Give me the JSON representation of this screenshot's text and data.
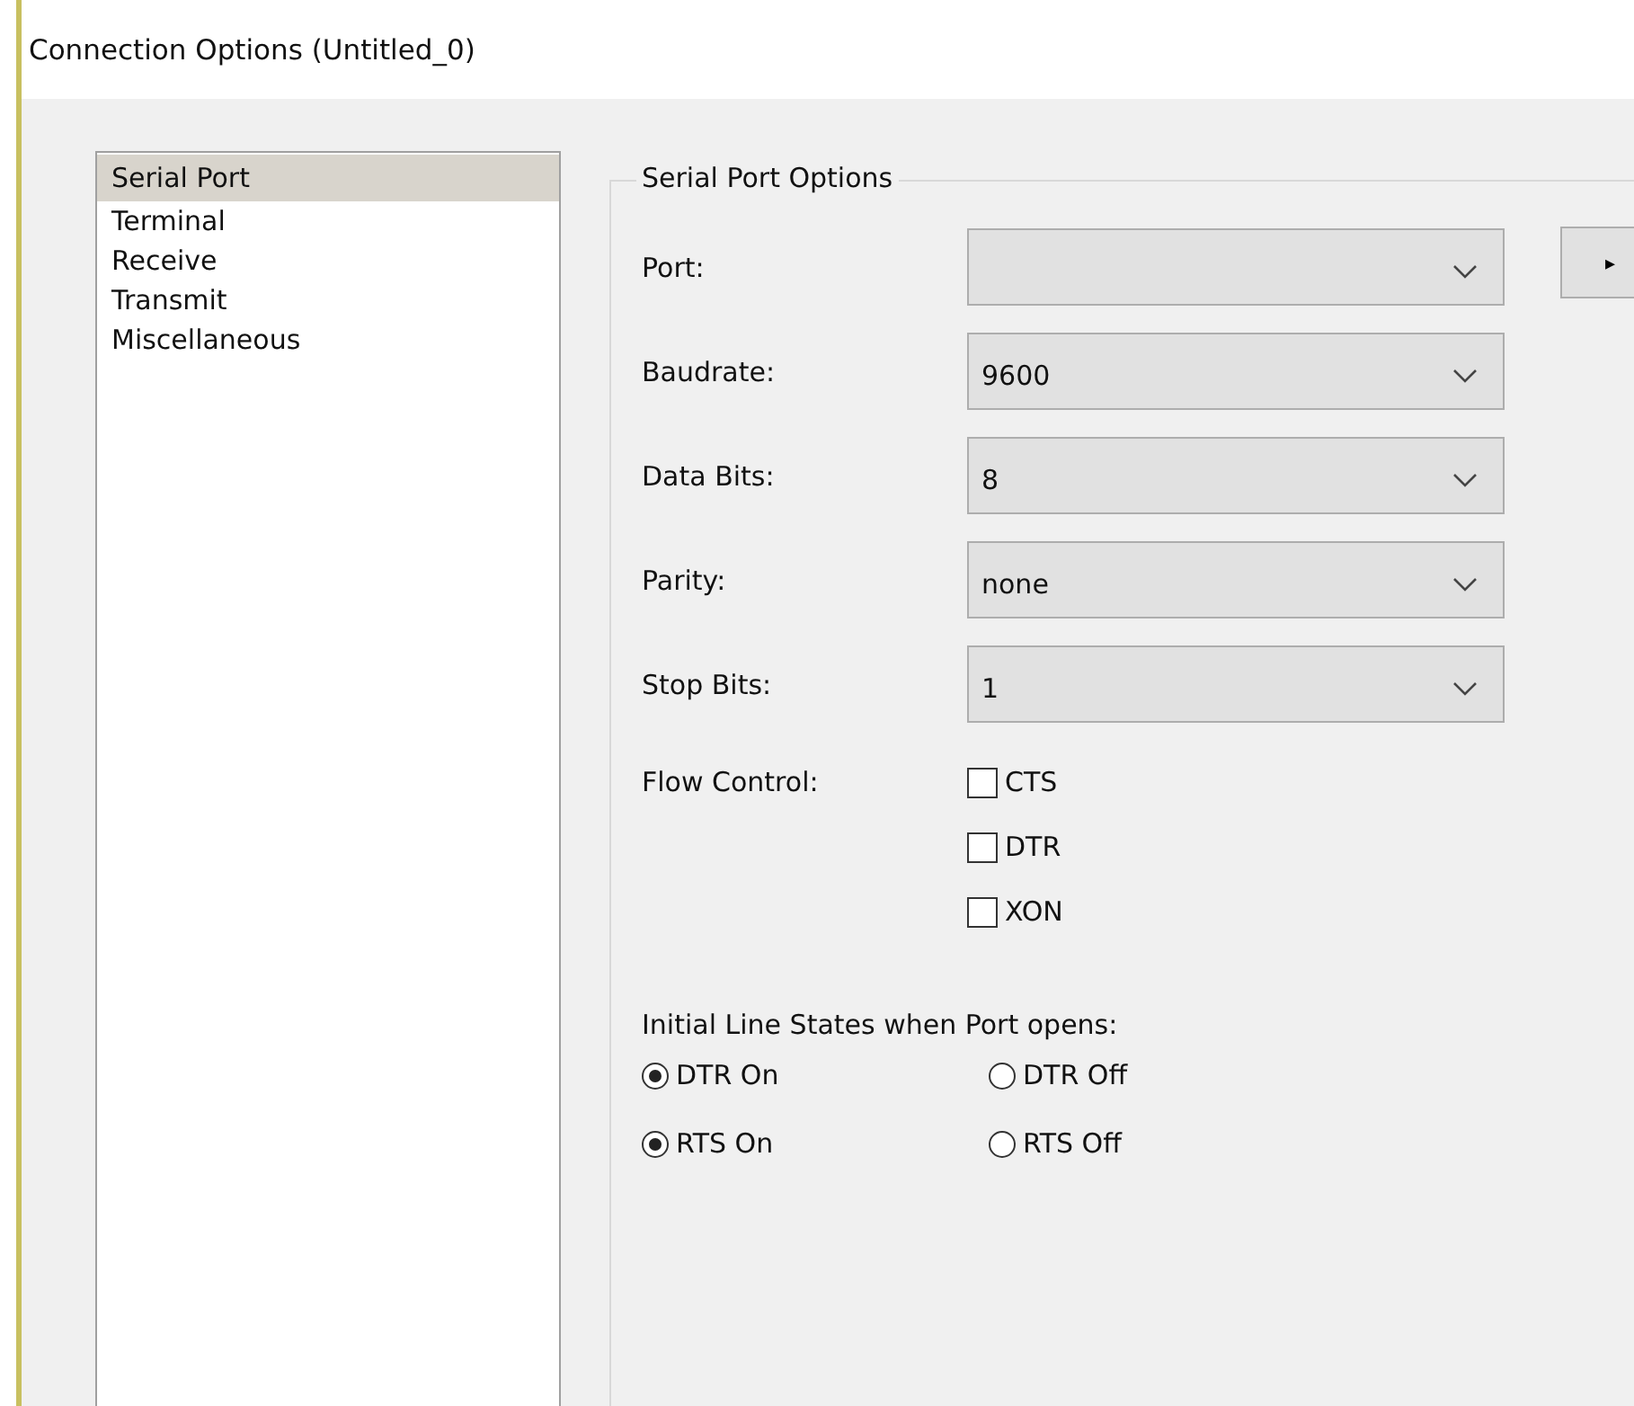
{
  "window": {
    "title": "Connection Options (Untitled_0)"
  },
  "sidebar": {
    "items": [
      {
        "label": "Serial Port",
        "selected": true
      },
      {
        "label": "Terminal",
        "selected": false
      },
      {
        "label": "Receive",
        "selected": false
      },
      {
        "label": "Transmit",
        "selected": false
      },
      {
        "label": "Miscellaneous",
        "selected": false
      }
    ]
  },
  "group": {
    "title": "Serial Port Options",
    "fields": [
      {
        "label": "Port:",
        "side_button": "▸"
      },
      {
        "label": "Baudrate:",
        "value": "9600"
      },
      {
        "label": "Data Bits:",
        "value": "8"
      },
      {
        "label": "Parity:",
        "value": "none"
      },
      {
        "label": "Stop Bits:",
        "value": "1"
      }
    ],
    "flow_control": {
      "label": "Flow Control:",
      "options": [
        {
          "label": "CTS",
          "checked": false
        },
        {
          "label": "DTR",
          "checked": false
        },
        {
          "label": "XON",
          "checked": false
        }
      ]
    },
    "line_states": {
      "label": "Initial Line States when Port opens:",
      "rows": [
        {
          "options": [
            {
              "label": "DTR On",
              "selected": true
            },
            {
              "label": "DTR Off",
              "selected": false
            }
          ]
        },
        {
          "options": [
            {
              "label": "RTS On",
              "selected": true
            },
            {
              "label": "RTS Off",
              "selected": false
            }
          ]
        }
      ]
    }
  }
}
